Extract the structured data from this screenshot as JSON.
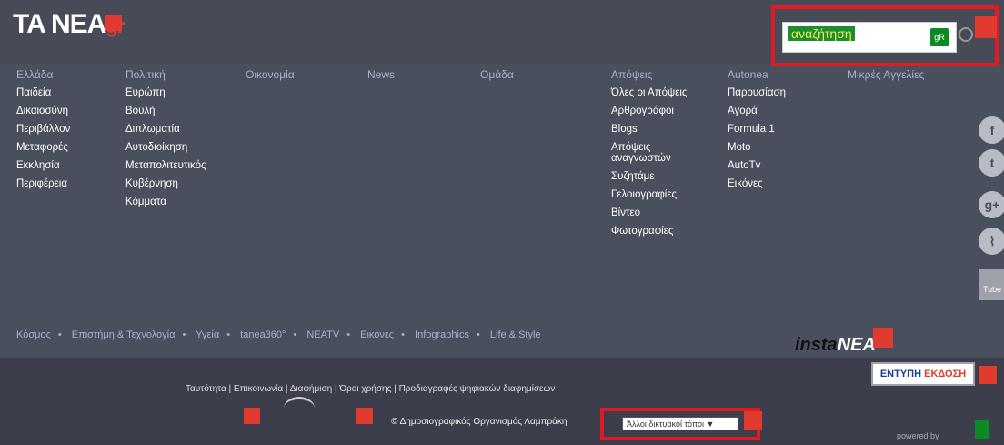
{
  "header": {
    "logo_main": "TA NEA",
    "logo_suffix": "gr",
    "search_placeholder": "αναζήτηση",
    "search_badge": "gR"
  },
  "nav": {
    "columns": [
      {
        "title": "Ελλάδα",
        "items": [
          "Παιδεία",
          "Δικαιοσύνη",
          "Περιβάλλον",
          "Μεταφορές",
          "Εκκλησία",
          "Περιφέρεια"
        ]
      },
      {
        "title": "Πολιτική",
        "items": [
          "Ευρώπη",
          "Βουλή",
          "Διπλωματία",
          "Αυτοδιοίκηση",
          "Μεταπολιτευτικός",
          "Κυβέρνηση",
          "Κόμματα"
        ]
      },
      {
        "title": "Οικονομία",
        "items": []
      },
      {
        "title": "Νews",
        "items": []
      },
      {
        "title": "Ομάδα",
        "items": []
      },
      {
        "title": "Απόψεις",
        "items": [
          "Όλες οι Απόψεις",
          "Αρθρογράφοι",
          "Blogs",
          "Απόψεις αναγνωστών",
          "Συζητάμε",
          "Γελοιογραφίες",
          "Βίντεο",
          "Φωτογραφίες"
        ]
      },
      {
        "title": "Autonea",
        "items": [
          "Παρουσίαση",
          "Αγορά",
          "Formula 1",
          "Moto",
          "AutoTv",
          "Εικόνες"
        ]
      },
      {
        "title": "Μικρές Αγγελίες",
        "items": []
      }
    ]
  },
  "social": {
    "icons": [
      {
        "name": "facebook-icon",
        "glyph": "f"
      },
      {
        "name": "twitter-icon",
        "glyph": "t"
      },
      {
        "name": "google-plus-icon",
        "glyph": "g+"
      },
      {
        "name": "rss-icon",
        "glyph": "⌇"
      }
    ],
    "youtube_label": "Tube"
  },
  "bottom_links": [
    "Κόσμος",
    "Επιστήμη & Τεχνολογία",
    "Υγεία",
    "tanea360°",
    "NEATV",
    "Εικόνες",
    "Infographics",
    "Life & Style"
  ],
  "instanea": {
    "prefix": "insta",
    "suffix": "NEA"
  },
  "footer": {
    "links": [
      "Ταυτότητα",
      "Επικοινωνία",
      "Διαφήμιση",
      "Όροι χρήσης",
      "Προδιαγραφές ψηφιακών διαφημίσεων"
    ],
    "print_label_1": "ΕΝΤΥΠΗ",
    "print_label_2": "ΕΚΔΟΣΗ",
    "copyright": "© Δημοσιογραφικός Οργανισμός Λαμπράκη",
    "select_value": "Άλλοι δικτυακοί τόποι",
    "powered": "powered by"
  },
  "colors": {
    "accent_red": "#e21b23",
    "bg": "#4a4f5d",
    "nav_head": "#a7b0cc"
  }
}
